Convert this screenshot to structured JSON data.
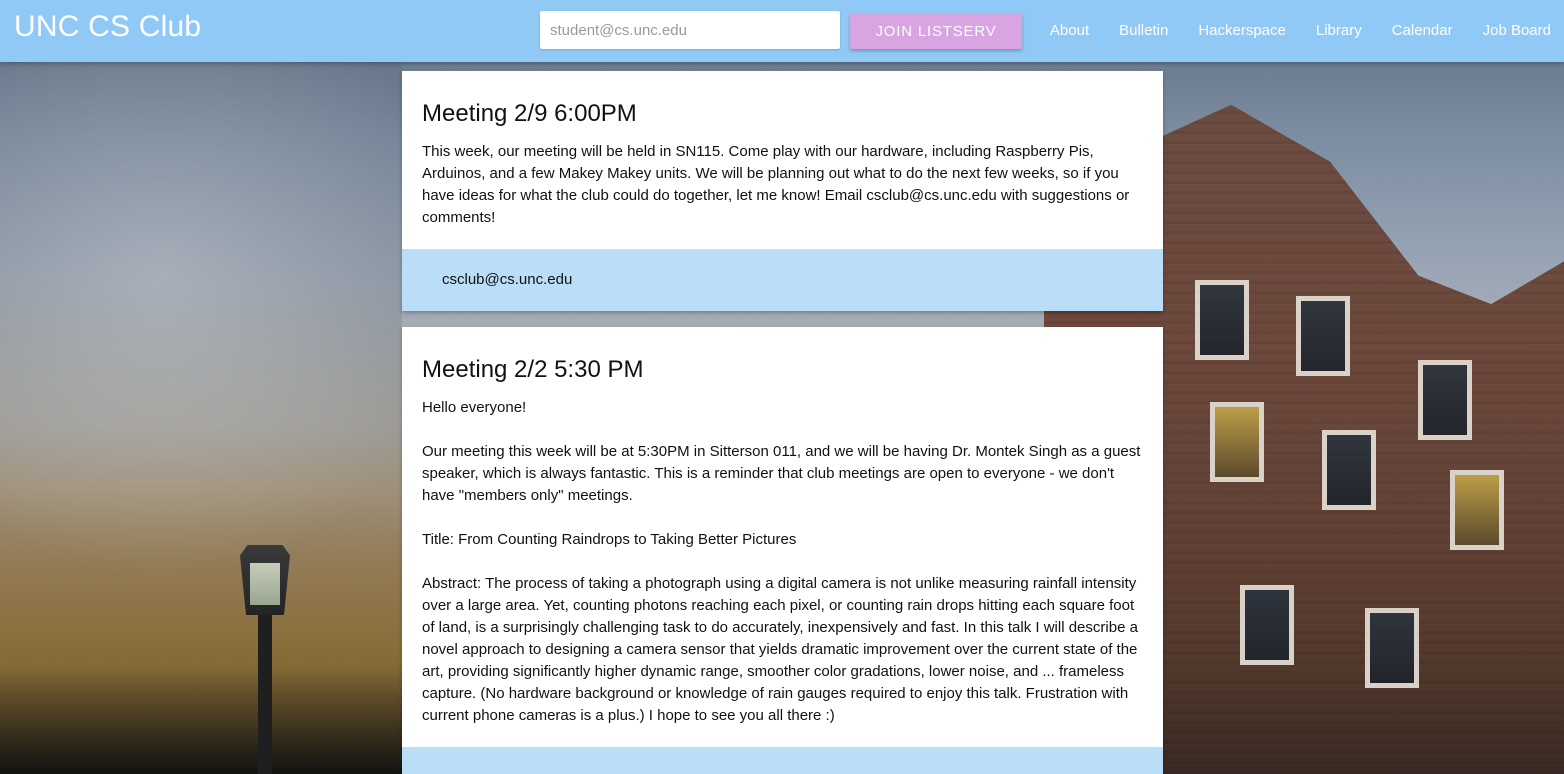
{
  "header": {
    "brand": "UNC CS Club",
    "email_placeholder": "student@cs.unc.edu",
    "join_label": "JOIN LISTSERV",
    "nav": [
      {
        "label": "About"
      },
      {
        "label": "Bulletin"
      },
      {
        "label": "Hackerspace"
      },
      {
        "label": "Library"
      },
      {
        "label": "Calendar"
      },
      {
        "label": "Job Board"
      }
    ]
  },
  "posts": [
    {
      "title": "Meeting 2/9 6:00PM",
      "paragraphs": [
        "This week, our meeting will be held in SN115. Come play with our hardware, including Raspberry Pis, Arduinos, and a few Makey Makey units. We will be planning out what to do the next few weeks, so if you have ideas for what the club could do together, let me know! Email csclub@cs.unc.edu with suggestions or comments!"
      ],
      "footer_link": "csclub@cs.unc.edu"
    },
    {
      "title": "Meeting 2/2 5:30 PM",
      "paragraphs": [
        "Hello everyone!",
        "Our meeting this week will be at 5:30PM in Sitterson 011, and we will be having Dr. Montek Singh as a guest speaker, which is always fantastic. This is a reminder that club meetings are open to everyone - we don't have \"members only\" meetings.",
        "Title: From Counting Raindrops to Taking Better Pictures",
        "Abstract: The process of taking a photograph using a digital camera is not unlike measuring rainfall intensity over a large area. Yet, counting photons reaching each pixel, or counting rain drops hitting each square foot of land, is a surprisingly challenging task to do accurately, inexpensively and fast. In this talk I will describe a novel approach to designing a camera sensor that yields dramatic improvement over the current state of the art, providing significantly higher dynamic range, smoother color gradations, lower noise, and ... frameless capture. (No hardware background or knowledge of rain gauges required to enjoy this talk. Frustration with current phone cameras is a plus.) I hope to see you all there :)"
      ]
    }
  ]
}
